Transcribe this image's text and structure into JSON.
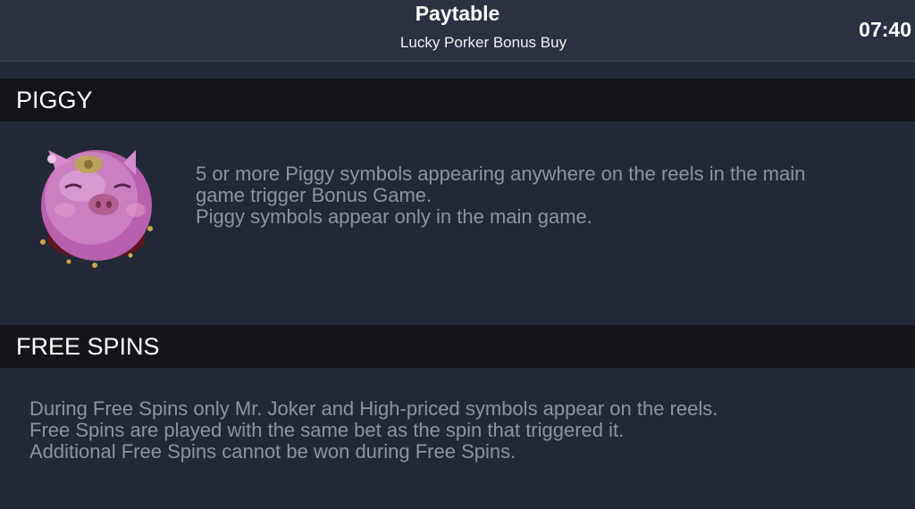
{
  "header": {
    "title": "Paytable",
    "subtitle": "Lucky Porker Bonus Buy",
    "clock": "07:40"
  },
  "sections": [
    {
      "title": "PIGGY",
      "icon": "piggy-symbol-icon",
      "lines": [
        "5 or more Piggy symbols appearing anywhere on the reels in the main",
        "game trigger Bonus Game.",
        "Piggy symbols appear only in the main game."
      ]
    },
    {
      "title": "FREE SPINS",
      "lines": [
        "During Free Spins only Mr. Joker and High-priced symbols appear on the reels.",
        "Free Spins are played with the same bet as the spin that triggered it.",
        "Additional Free Spins cannot be won during Free Spins."
      ]
    }
  ],
  "colors": {
    "background": "#232836",
    "header_background": "#2b3142",
    "section_bar": "#141519",
    "body_text": "#8a93a6",
    "pig_pink": "#c77ac0"
  }
}
